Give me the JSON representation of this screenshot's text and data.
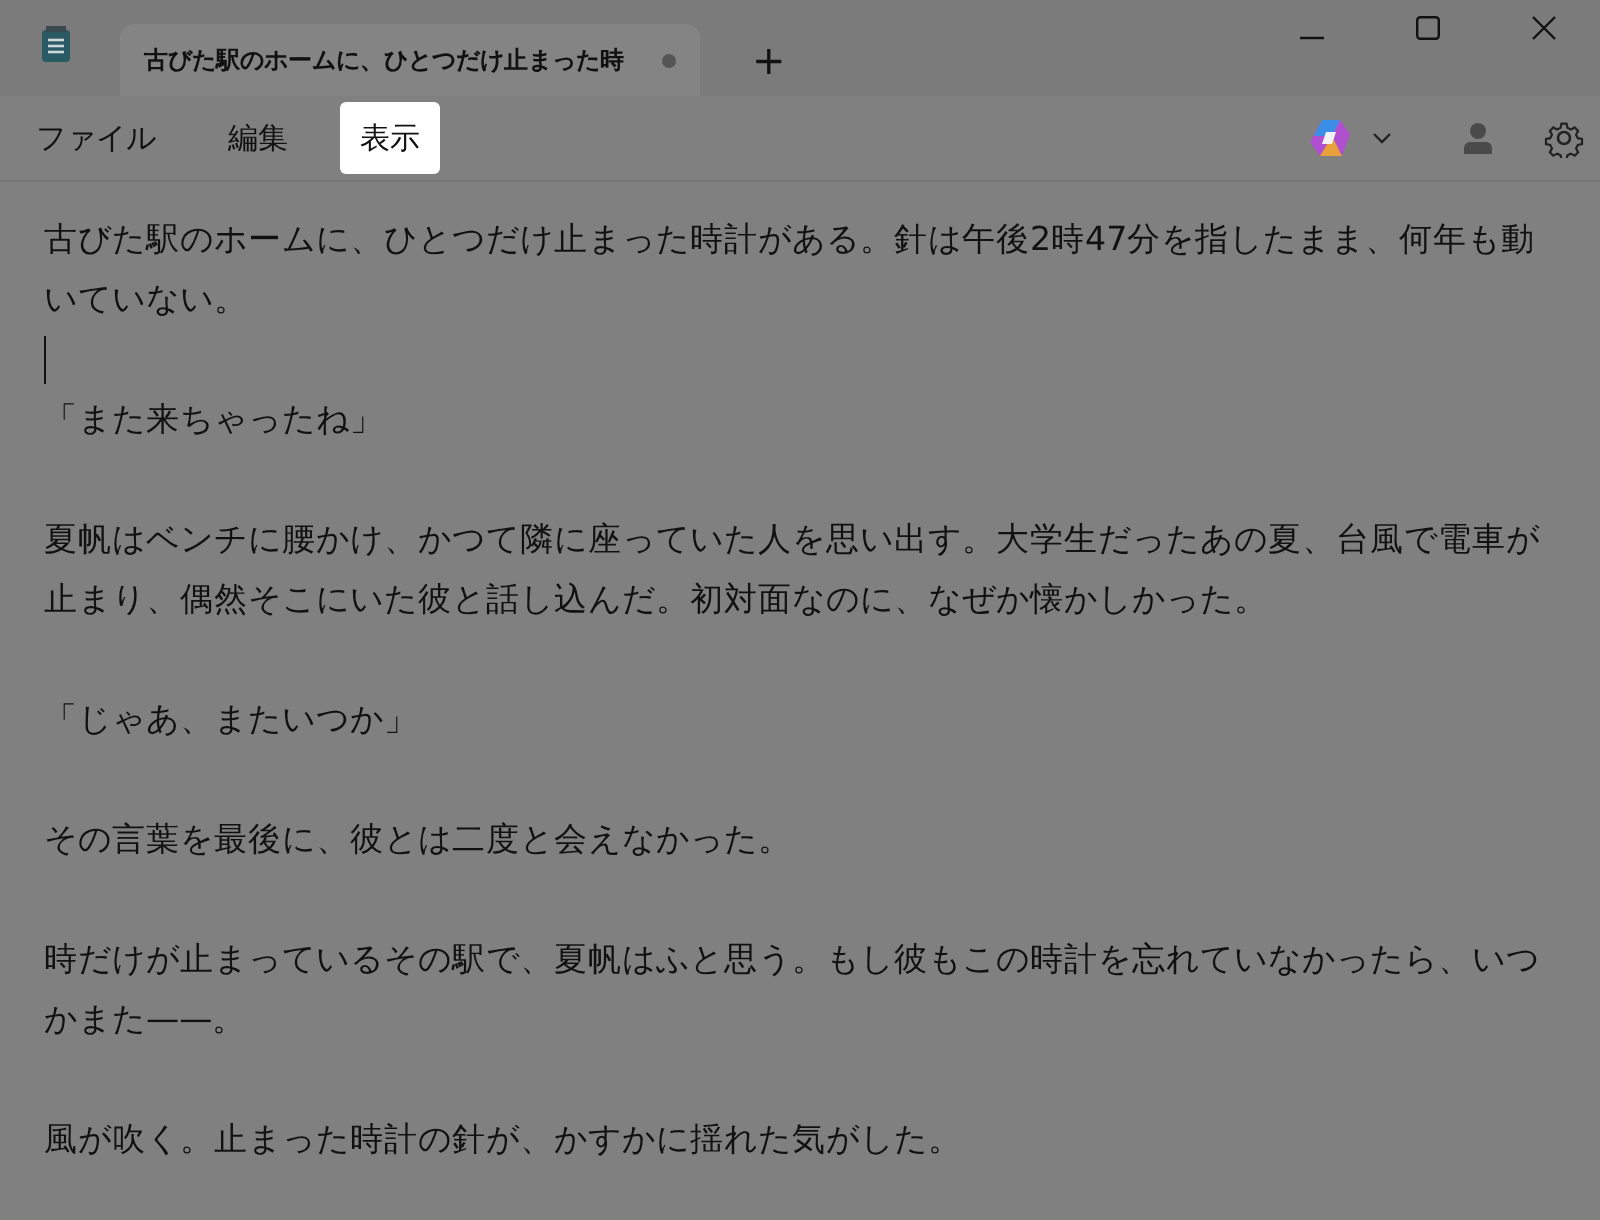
{
  "tab": {
    "title": "古びた駅のホームに、ひとつだけ止まった時",
    "modified": true,
    "new_tab_label": "+"
  },
  "menu": [
    {
      "label": "ファイル",
      "selected": false
    },
    {
      "label": "編集",
      "selected": false
    },
    {
      "label": "表示",
      "selected": true
    }
  ],
  "lines": [
    {
      "kind": "text",
      "text": "古びた駅のホームに、ひとつだけ止まった時計がある。針は午後2時47分を指したまま、何年も動いていない。"
    },
    {
      "kind": "blank",
      "caret": true
    },
    {
      "kind": "text",
      "text": "「また来ちゃったね」"
    },
    {
      "kind": "blank"
    },
    {
      "kind": "text",
      "text": "夏帆はベンチに腰かけ、かつて隣に座っていた人を思い出す。大学生だったあの夏、台風で電車が止まり、偶然そこにいた彼と話し込んだ。初対面なのに、なぜか懐かしかった。"
    },
    {
      "kind": "blank"
    },
    {
      "kind": "text",
      "text": "「じゃあ、またいつか」"
    },
    {
      "kind": "blank"
    },
    {
      "kind": "text",
      "text": "その言葉を最後に、彼とは二度と会えなかった。"
    },
    {
      "kind": "blank"
    },
    {
      "kind": "text",
      "text": "時だけが止まっているその駅で、夏帆はふと思う。もし彼もこの時計を忘れていなかったら、いつかまた——。"
    },
    {
      "kind": "blank"
    },
    {
      "kind": "text",
      "text": "風が吹く。止まった時計の針が、かすかに揺れた気がした。"
    }
  ]
}
